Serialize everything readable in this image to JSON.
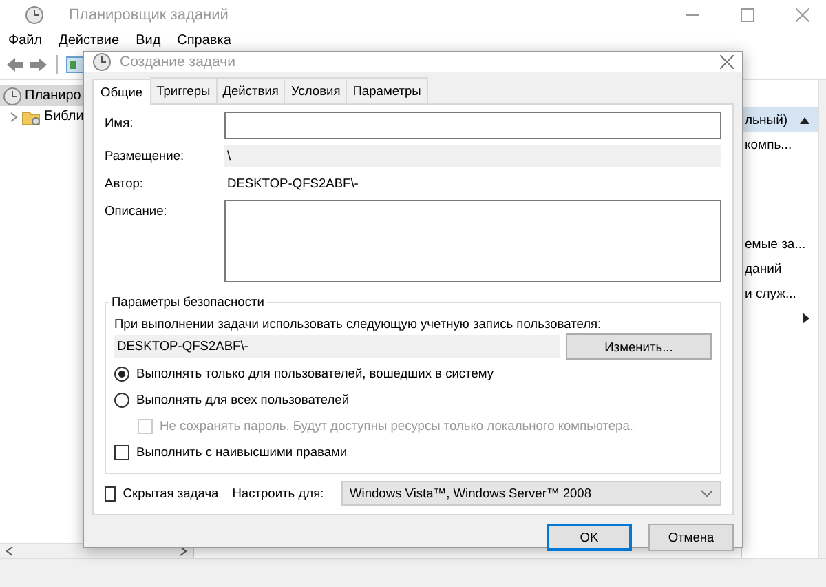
{
  "main_window": {
    "title": "Планировщик заданий",
    "menu": [
      "Файл",
      "Действие",
      "Вид",
      "Справка"
    ],
    "tree": [
      {
        "label": "Планиро",
        "selected": true,
        "children": [
          {
            "label": "Библи",
            "selected": false,
            "expanded": false
          }
        ]
      }
    ],
    "actions": [
      {
        "kind": "header",
        "label": "льный)"
      },
      {
        "kind": "item",
        "label": "компь..."
      },
      {
        "kind": "item",
        "label": "емые за..."
      },
      {
        "kind": "item",
        "label": "даний"
      },
      {
        "kind": "item",
        "label": "и служ..."
      },
      {
        "kind": "submenu"
      }
    ]
  },
  "dialog": {
    "title": "Создание задачи",
    "tabs": [
      {
        "label": "Общие",
        "selected": true
      },
      {
        "label": "Триггеры",
        "selected": false
      },
      {
        "label": "Действия",
        "selected": false
      },
      {
        "label": "Условия",
        "selected": false
      },
      {
        "label": "Параметры",
        "selected": false
      }
    ],
    "fields": [
      {
        "kind": "input",
        "label": "Имя:"
      },
      {
        "kind": "readonly",
        "label": "Размещение:",
        "value": "\\"
      },
      {
        "kind": "text",
        "label": "Автор:",
        "value": "DESKTOP-QFS2ABF\\-"
      },
      {
        "kind": "textarea",
        "label": "Описание:"
      }
    ],
    "security": {
      "title": "Параметры безопасности",
      "prompt": "При выполнении задачи использовать следующую учетную запись пользователя:",
      "account": "DESKTOP-QFS2ABF\\-",
      "change_button": "Изменить...",
      "options": [
        {
          "kind": "radio",
          "label": "Выполнять только для пользователей, вошедших в систему",
          "selected": true
        },
        {
          "kind": "radio",
          "label": "Выполнять для всех пользователей",
          "selected": false,
          "children": [
            {
              "kind": "checkbox",
              "label": "Не сохранять пароль. Будут доступны ресурсы только локального компьютера.",
              "checked": false,
              "disabled": true
            }
          ]
        },
        {
          "kind": "checkbox",
          "label": "Выполнить с наивысшими правами",
          "checked": false,
          "disabled": false
        }
      ]
    },
    "hidden_task": {
      "label": "Скрытая задача",
      "checked": false
    },
    "configure": {
      "label": "Настроить для:",
      "value": "Windows Vista™, Windows Server™ 2008"
    },
    "buttons": [
      {
        "label": "OK",
        "default": true
      },
      {
        "label": "Отмена",
        "default": false
      }
    ]
  }
}
